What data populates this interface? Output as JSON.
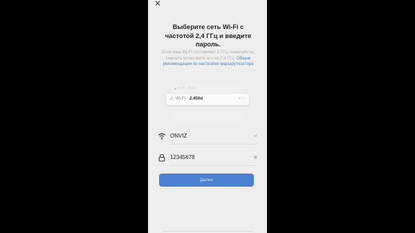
{
  "screen": {
    "title": "Выберите сеть Wi-Fi с частотой 2,4 ГГц и введите пароль.",
    "description": "Если ваш Wi-Fi составляет 5 ГГц, пожалуйста, сначала установите его на 2,4 ГГц.",
    "link_text": "Общие рекомендации по настройке маршрутизатора"
  },
  "illustration": {
    "top_label": "Wi-Fi · 5Ghz",
    "wifi_label": "Wi-Fi",
    "band_label": "2.4Ghz"
  },
  "network": {
    "ssid": "ONVIZ",
    "password": "12345678"
  },
  "actions": {
    "next_label": "Далее"
  },
  "colors": {
    "accent": "#4a80cf",
    "link": "#4a83c4",
    "background": "#eeeeee"
  },
  "icons": [
    "close-icon",
    "wifi-icon",
    "lock-icon",
    "swap-icon",
    "eye-icon",
    "check-icon"
  ]
}
